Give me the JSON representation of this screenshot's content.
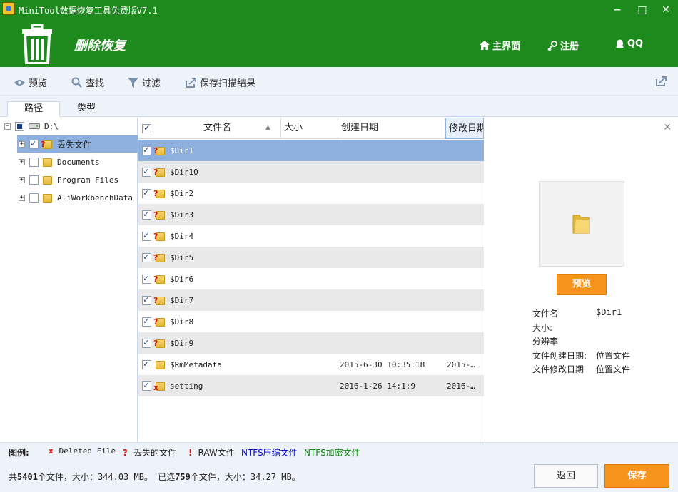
{
  "window": {
    "title": "MiniTool数据恢复工具免费版V7.1",
    "minimize": "−",
    "maximize": "□",
    "close": "✕"
  },
  "header": {
    "section_title": "删除恢复",
    "nav": [
      {
        "label": "主界面",
        "icon": "home-icon"
      },
      {
        "label": "注册",
        "icon": "key-icon"
      },
      {
        "label": "QQ",
        "icon": "qq-icon"
      }
    ]
  },
  "toolbar": {
    "preview": "预览",
    "find": "查找",
    "filter": "过滤",
    "save_scan": "保存扫描结果"
  },
  "tabs": [
    "路径",
    "类型"
  ],
  "tree": {
    "root": "D:\\",
    "children": [
      {
        "label": "丢失文件",
        "selected": true,
        "checked": true,
        "kind": "lost"
      },
      {
        "label": "Documents",
        "selected": false,
        "checked": false,
        "kind": "folder"
      },
      {
        "label": "Program Files",
        "selected": false,
        "checked": false,
        "kind": "folder"
      },
      {
        "label": "AliWorkbenchData",
        "selected": false,
        "checked": false,
        "kind": "folder"
      }
    ]
  },
  "table": {
    "columns": [
      "文件名",
      "大小",
      "创建日期",
      "修改日期"
    ],
    "rows": [
      {
        "name": "$Dir1",
        "size": "",
        "created": "",
        "modified": "",
        "kind": "lost",
        "selected": true
      },
      {
        "name": "$Dir10",
        "size": "",
        "created": "",
        "modified": "",
        "kind": "lost"
      },
      {
        "name": "$Dir2",
        "size": "",
        "created": "",
        "modified": "",
        "kind": "lost"
      },
      {
        "name": "$Dir3",
        "size": "",
        "created": "",
        "modified": "",
        "kind": "lost"
      },
      {
        "name": "$Dir4",
        "size": "",
        "created": "",
        "modified": "",
        "kind": "lost"
      },
      {
        "name": "$Dir5",
        "size": "",
        "created": "",
        "modified": "",
        "kind": "lost"
      },
      {
        "name": "$Dir6",
        "size": "",
        "created": "",
        "modified": "",
        "kind": "lost"
      },
      {
        "name": "$Dir7",
        "size": "",
        "created": "",
        "modified": "",
        "kind": "lost"
      },
      {
        "name": "$Dir8",
        "size": "",
        "created": "",
        "modified": "",
        "kind": "lost"
      },
      {
        "name": "$Dir9",
        "size": "",
        "created": "",
        "modified": "",
        "kind": "lost"
      },
      {
        "name": "$RmMetadata",
        "size": "",
        "created": "2015-6-30 10:35:18",
        "modified": "2015-…",
        "kind": "folder"
      },
      {
        "name": "setting",
        "size": "",
        "created": "2016-1-26 14:1:9",
        "modified": "2016-…",
        "kind": "deleted"
      }
    ]
  },
  "preview": {
    "button": "预览",
    "fields": [
      {
        "key": "文件名",
        "value": "$Dir1"
      },
      {
        "key": "大小:",
        "value": ""
      },
      {
        "key": "分辨率",
        "value": ""
      },
      {
        "key": "文件创建日期:",
        "value": "位置文件"
      },
      {
        "key": "文件修改日期",
        "value": "位置文件"
      }
    ]
  },
  "legend": {
    "title": "图例:",
    "items": [
      {
        "mark": "x",
        "label": "Deleted File",
        "color": "#222222"
      },
      {
        "mark": "?",
        "label": "丢失的文件",
        "color": "#222222"
      },
      {
        "mark": "!",
        "label": "RAW文件",
        "color": "#222222"
      },
      {
        "mark": "",
        "label": "NTFS压缩文件",
        "color": "#0000cc"
      },
      {
        "mark": "",
        "label": "NTFS加密文件",
        "color": "#0a8a0a"
      }
    ]
  },
  "status": {
    "p1": "共",
    "total_count": "5401",
    "p2": "个文件，大小：",
    "total_size": "344.03 MB",
    "p3": "。 已选",
    "selected_count": "759",
    "p4": "个文件，大小：",
    "selected_size": "34.27 MB",
    "p5": "。"
  },
  "buttons": {
    "back": "返回",
    "save": "保存"
  },
  "colors": {
    "header_green": "#1e8a1e",
    "accent_orange": "#f7941d",
    "selection_blue": "#8db0de"
  }
}
